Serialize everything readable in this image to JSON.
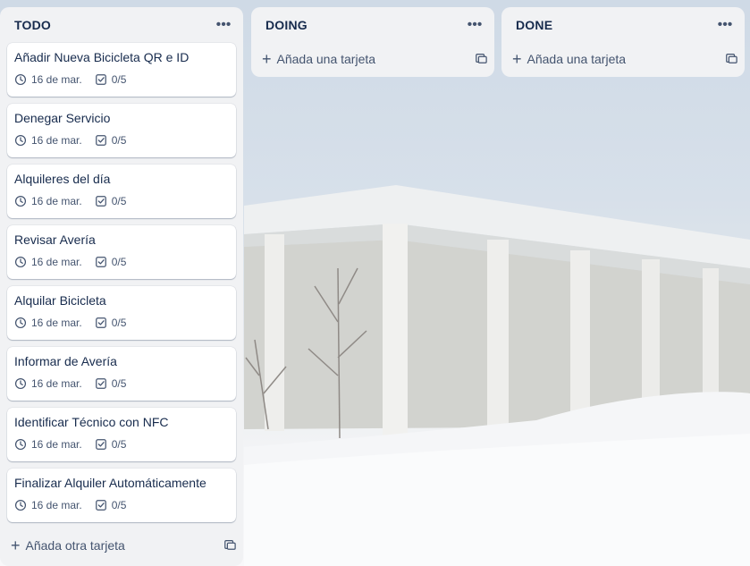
{
  "lists": [
    {
      "title": "TODO",
      "cards": [
        {
          "title": "Añadir Nueva Bicicleta QR e ID",
          "date": "16 de mar.",
          "checklist": "0/5"
        },
        {
          "title": "Denegar Servicio",
          "date": "16 de mar.",
          "checklist": "0/5"
        },
        {
          "title": "Alquileres del día",
          "date": "16 de mar.",
          "checklist": "0/5"
        },
        {
          "title": "Revisar Avería",
          "date": "16 de mar.",
          "checklist": "0/5"
        },
        {
          "title": "Alquilar Bicicleta",
          "date": "16 de mar.",
          "checklist": "0/5"
        },
        {
          "title": "Informar de Avería",
          "date": "16 de mar.",
          "checklist": "0/5"
        },
        {
          "title": "Identificar Técnico con NFC",
          "date": "16 de mar.",
          "checklist": "0/5"
        },
        {
          "title": "Finalizar Alquiler Automáticamente",
          "date": "16 de mar.",
          "checklist": "0/5"
        }
      ],
      "add_label": "Añada otra tarjeta"
    },
    {
      "title": "DOING",
      "cards": [],
      "add_label": "Añada una tarjeta"
    },
    {
      "title": "DONE",
      "cards": [],
      "add_label": "Añada una tarjeta"
    }
  ],
  "icons": {
    "more": "more-horizontal-icon",
    "clock": "clock-icon",
    "checklist": "checklist-icon",
    "plus": "plus-icon",
    "template": "card-template-icon"
  }
}
